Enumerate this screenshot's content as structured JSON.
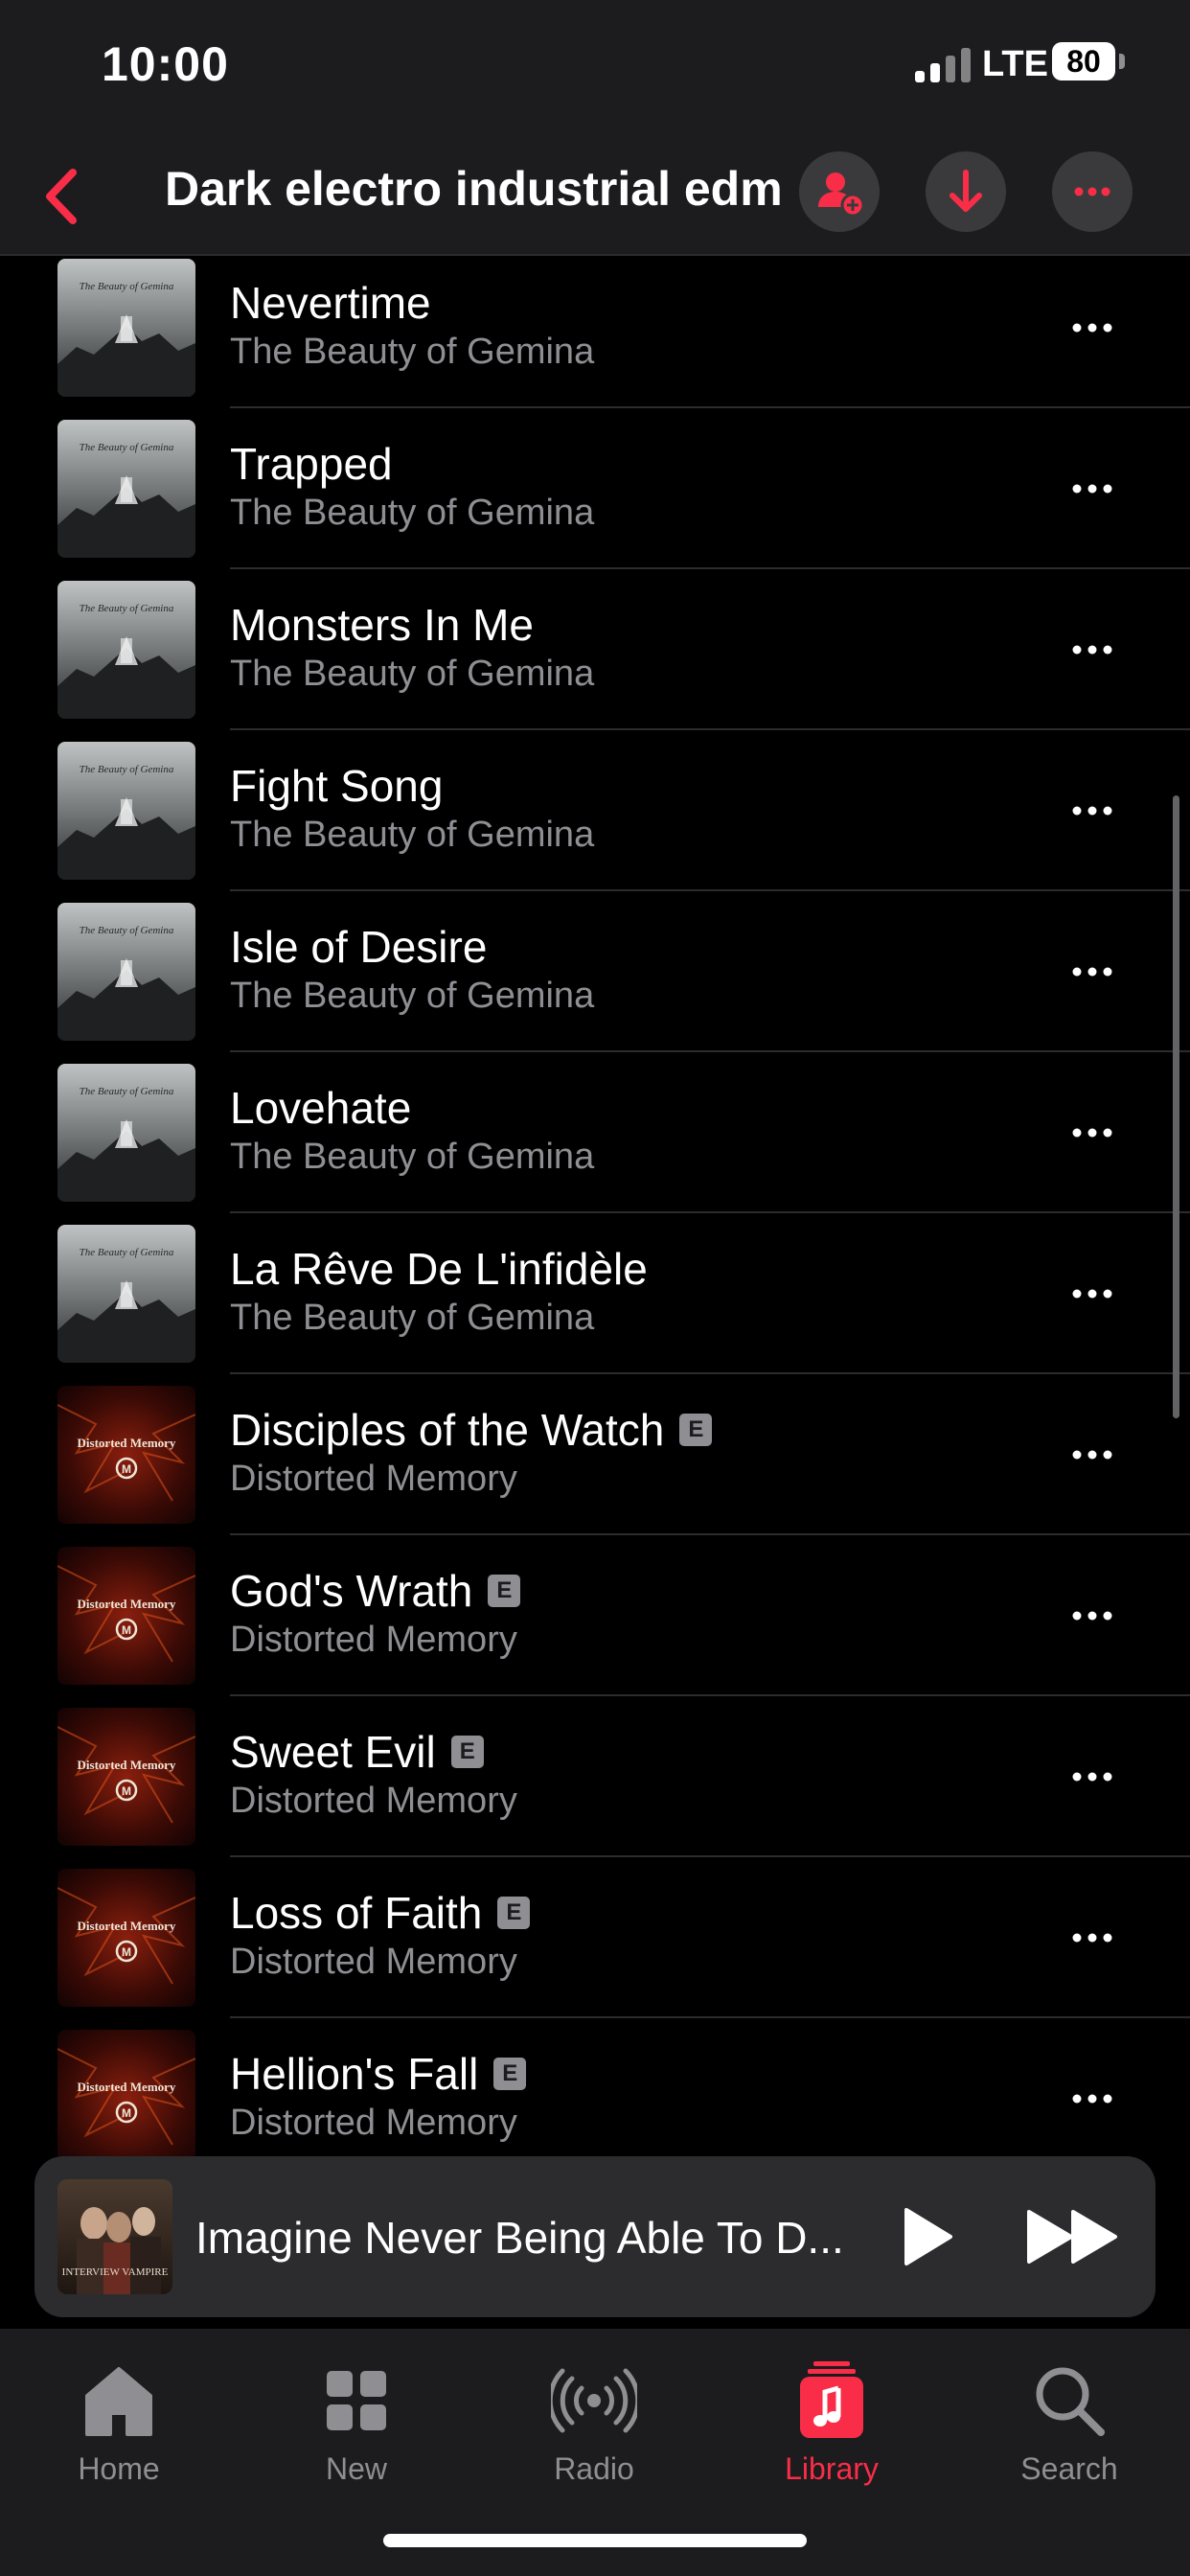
{
  "status_bar": {
    "time": "10:00",
    "network": "LTE",
    "battery": "80"
  },
  "header": {
    "title": "Dark electro industrial edm"
  },
  "songs": [
    {
      "title": "Nevertime",
      "artist": "The Beauty of Gemina",
      "explicit": false,
      "art": "gemina-cover"
    },
    {
      "title": "Trapped",
      "artist": "The Beauty of Gemina",
      "explicit": false,
      "art": "gemina-cover"
    },
    {
      "title": "Monsters In Me",
      "artist": "The Beauty of Gemina",
      "explicit": false,
      "art": "gemina-cover"
    },
    {
      "title": "Fight Song",
      "artist": "The Beauty of Gemina",
      "explicit": false,
      "art": "gemina-cover"
    },
    {
      "title": "Isle of Desire",
      "artist": "The Beauty of Gemina",
      "explicit": false,
      "art": "gemina-cover"
    },
    {
      "title": "Lovehate",
      "artist": "The Beauty of Gemina",
      "explicit": false,
      "art": "gemina-cover"
    },
    {
      "title": "La Rêve De L'infidèle",
      "artist": "The Beauty of Gemina",
      "explicit": false,
      "art": "gemina-cover"
    },
    {
      "title": "Disciples of the Watch",
      "artist": "Distorted Memory",
      "explicit": true,
      "art": "distorted-memory-cover"
    },
    {
      "title": "God's Wrath",
      "artist": "Distorted Memory",
      "explicit": true,
      "art": "distorted-memory-cover"
    },
    {
      "title": "Sweet Evil",
      "artist": "Distorted Memory",
      "explicit": true,
      "art": "distorted-memory-cover"
    },
    {
      "title": "Loss of Faith",
      "artist": "Distorted Memory",
      "explicit": true,
      "art": "distorted-memory-cover"
    },
    {
      "title": "Hellion's Fall",
      "artist": "Distorted Memory",
      "explicit": true,
      "art": "distorted-memory-cover"
    }
  ],
  "explicit_label": "E",
  "cover_text": {
    "gemina": "The Beauty of Gemina",
    "distorted": "Distorted Memory",
    "mini": "INTERVIEW VAMPIRE"
  },
  "now_playing": {
    "title": "Imagine Never Being Able To D..."
  },
  "tabs": [
    {
      "label": "Home",
      "icon": "home-icon",
      "active": false
    },
    {
      "label": "New",
      "icon": "grid-icon",
      "active": false
    },
    {
      "label": "Radio",
      "icon": "radio-icon",
      "active": false
    },
    {
      "label": "Library",
      "icon": "library-icon",
      "active": true
    },
    {
      "label": "Search",
      "icon": "search-icon",
      "active": false
    }
  ],
  "colors": {
    "accent": "#fa2d48",
    "background": "#000000",
    "secondary_text": "#8e8e93"
  }
}
